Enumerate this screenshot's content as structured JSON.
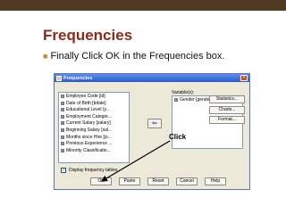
{
  "slide": {
    "title": "Frequencies",
    "bullet": "Finally Click OK in the Frequencies box."
  },
  "dialog": {
    "title": "Frequencies",
    "variables": [
      {
        "label": "Employee Code [id]"
      },
      {
        "label": "Date of Birth [bdate]"
      },
      {
        "label": "Educational Level (y..."
      },
      {
        "label": "Employment Categor..."
      },
      {
        "label": "Current Salary [salary]"
      },
      {
        "label": "Beginning Salary [sal..."
      },
      {
        "label": "Months since Hire [jo..."
      },
      {
        "label": "Previous Experience ..."
      },
      {
        "label": "Minority Classificatio..."
      }
    ],
    "variables_header": "Variable(s):",
    "selected_variable": "Gender [gender]",
    "arrow_glyph": "⇐",
    "buttons": {
      "statistics": "Statistics...",
      "charts": "Charts...",
      "format": "Format..."
    },
    "checkbox_label": "Display frequency tables",
    "checkbox_checked": true,
    "bottom_buttons": {
      "ok": "OK",
      "paste": "Paste",
      "reset": "Reset",
      "cancel": "Cancel",
      "help": "Help"
    }
  },
  "annotation": {
    "label": "Click"
  },
  "colors": {
    "title": "#8b2a1c",
    "top_bar": "#4f3b22",
    "bullet": "#c98a2b",
    "dialog_bg": "#ece9d8",
    "titlebar": "#2a5ad0"
  }
}
